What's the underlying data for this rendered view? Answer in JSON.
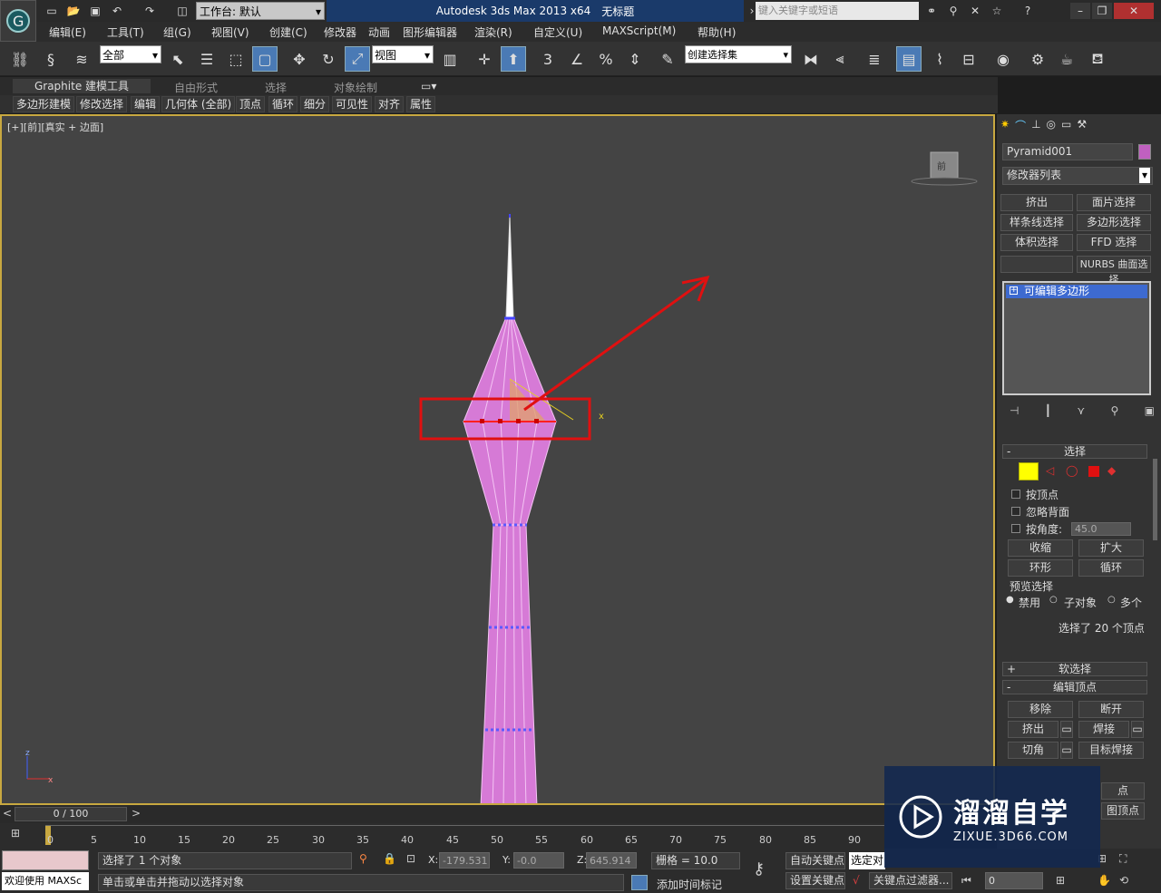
{
  "title_bar": {
    "workspace_label": "工作台: 默认",
    "app_name": "Autodesk 3ds Max  2013 x64",
    "doc_name": "无标题",
    "search_placeholder": "键入关键字或短语"
  },
  "menu": [
    "编辑(E)",
    "工具(T)",
    "组(G)",
    "视图(V)",
    "创建(C)",
    "修改器",
    "动画",
    "图形编辑器",
    "渲染(R)",
    "自定义(U)",
    "MAXScript(M)",
    "帮助(H)"
  ],
  "toolbar": {
    "selection_filter": "全部",
    "ref_coord": "视图",
    "named_selection": "创建选择集",
    "snap_3": "3",
    "snap_percent": "%"
  },
  "ribbon": {
    "tabs": [
      "Graphite 建模工具",
      "自由形式",
      "选择",
      "对象绘制"
    ],
    "subtabs": [
      "多边形建模",
      "修改选择",
      "编辑",
      "几何体 (全部)",
      "顶点",
      "循环",
      "细分",
      "可见性",
      "对齐",
      "属性"
    ]
  },
  "viewport": {
    "label": "[+][前][真实 + 边面]",
    "viewcube_label": "前",
    "axis_x": "x",
    "axis_z": "z"
  },
  "command_panel": {
    "object_name": "Pyramid001",
    "object_color": "#c060c0",
    "modifier_list": "修改器列表",
    "modifier_buttons": [
      "挤出",
      "面片选择",
      "样条线选择",
      "多边形选择",
      "体积选择",
      "FFD 选择",
      "",
      "NURBS 曲面选择"
    ],
    "stack_item": "可编辑多边形",
    "selection_rollup": "选择",
    "by_vertex": "按顶点",
    "ignore_backfacing": "忽略背面",
    "by_angle": "按角度:",
    "angle_value": "45.0",
    "shrink": "收缩",
    "grow": "扩大",
    "ring": "环形",
    "loop": "循环",
    "preview_selection": "预览选择",
    "preview_disabled": "禁用",
    "preview_subobject": "子对象",
    "preview_multi": "多个",
    "selected_count": "选择了 20 个顶点",
    "soft_selection": "软选择",
    "edit_vertices": "编辑顶点",
    "remove": "移除",
    "break": "断开",
    "extrude": "挤出",
    "weld": "焊接",
    "chamfer": "切角",
    "target_weld": "目标焊接",
    "partial_1": "点",
    "partial_2": "图顶点"
  },
  "timeline": {
    "frame_display": "0 / 100",
    "ticks": [
      "0",
      "5",
      "10",
      "15",
      "20",
      "25",
      "30",
      "35",
      "40",
      "45",
      "50",
      "55",
      "60",
      "65",
      "70",
      "75",
      "80",
      "85",
      "90"
    ]
  },
  "status": {
    "maxscript_label": "欢迎使用 MAXSc",
    "selected_objects": "选择了 1 个对象",
    "prompt": "单击或单击并拖动以选择对象",
    "x_label": "X:",
    "x_value": "-179.531",
    "y_label": "Y:",
    "y_value": "-0.0",
    "z_label": "Z:",
    "z_value": "645.914",
    "grid": "栅格 = 10.0",
    "auto_key": "自动关键点",
    "set_key": "设置关键点",
    "selected_dropdown": "选定对",
    "key_filters": "关键点过滤器...",
    "add_time_tag": "添加时间标记",
    "frame_value": "0"
  },
  "watermark": {
    "brand": "溜溜自学",
    "url": "ZIXUE.3D66.COM"
  }
}
